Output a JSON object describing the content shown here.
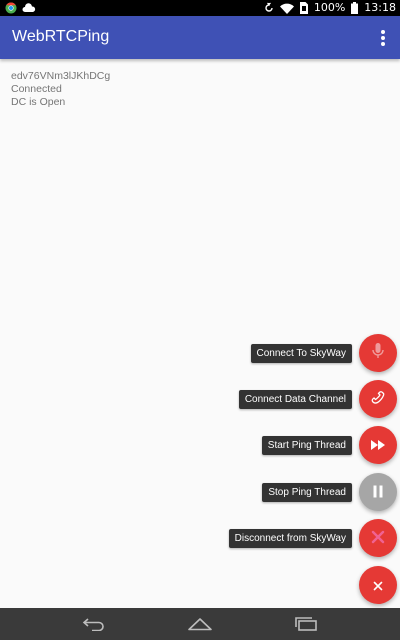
{
  "status_bar": {
    "battery": "100%",
    "time": "13:18",
    "icons": [
      "chrome-icon",
      "cloud-icon",
      "sync-icon",
      "wifi-icon",
      "sim-icon",
      "battery-icon"
    ]
  },
  "app_bar": {
    "title": "WebRTCPing",
    "overflow_icon": "more-vert-icon"
  },
  "content": {
    "peer_id": "edv76VNm3lJKhDCg",
    "connection_status": "Connected",
    "data_channel_status": "DC is Open"
  },
  "fab_menu": {
    "items": [
      {
        "label": "Connect To SkyWay",
        "icon": "mic-icon",
        "color": "#e53935"
      },
      {
        "label": "Connect Data Channel",
        "icon": "phone-icon",
        "color": "#e53935"
      },
      {
        "label": "Start Ping Thread",
        "icon": "fast-forward-icon",
        "color": "#e53935"
      },
      {
        "label": "Stop Ping Thread",
        "icon": "pause-icon",
        "color": "#a6a6a6"
      },
      {
        "label": "Disconnect from SkyWay",
        "icon": "close-icon",
        "color": "#e53935"
      }
    ],
    "main_icon": "close-icon"
  },
  "nav_bar": {
    "buttons": [
      "back-icon",
      "home-icon",
      "recents-icon"
    ]
  },
  "colors": {
    "primary": "#3f51b5",
    "accent": "#e53935",
    "disabled": "#a6a6a6"
  }
}
